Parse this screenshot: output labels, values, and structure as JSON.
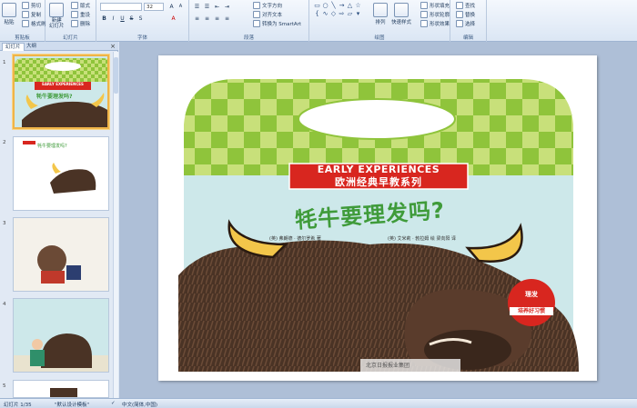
{
  "ribbon": {
    "clipboard": {
      "label": "剪贴板",
      "paste": "粘贴",
      "cut": "剪切",
      "copy": "复制",
      "format_painter": "格式刷"
    },
    "slides": {
      "label": "幻灯片",
      "new_slide": "新建\n幻灯片",
      "layout": "版式",
      "reset": "重设",
      "delete": "删除"
    },
    "font": {
      "label": "字体",
      "font_size": "32"
    },
    "paragraph": {
      "label": "段落",
      "text_direction": "文字方向",
      "align_text": "对齐文本",
      "smartart": "转换为 SmartArt"
    },
    "drawing": {
      "label": "绘图",
      "arrange": "排列",
      "quick_styles": "快速样式",
      "shape_fill": "形状填充",
      "shape_outline": "形状轮廓",
      "shape_effects": "形状效果"
    },
    "editing": {
      "label": "编辑",
      "find": "查找",
      "replace": "替换",
      "select": "选择"
    }
  },
  "panel": {
    "tabs": [
      "幻灯片",
      "大纲"
    ],
    "close": "×",
    "thumb_numbers": [
      "1",
      "2",
      "3",
      "4",
      "5"
    ]
  },
  "cover": {
    "banner_en": "EARLY EXPERIENCES",
    "banner_cn": "欧洲经典早教系列",
    "title": "牦牛要理发吗?",
    "credits_left": "(英) 弗朗德 · 德尔罗希  著",
    "credits_right": "(英) 艾米莉 · 勃拉姆   绘    梁向阳  译",
    "badge_top": "理发",
    "badge_bottom": "培养好习惯",
    "publisher": "北京日报报业集团"
  },
  "thumb_cover": {
    "banner_en": "EARLY EXPERIENCES",
    "title": "牦牛要理发吗?"
  },
  "thumb2": {
    "title": "牦牛要理发吗?"
  },
  "status": {
    "slide_count": "幻灯片 1/35",
    "theme": "\"默认设计模板\"",
    "language": "中文(简体,中国)"
  },
  "colors": {
    "checker_light": "#c8e07a",
    "checker_dark": "#8fc43b",
    "banner_red": "#d8261f",
    "sky_blue": "#cde8ea",
    "title_green": "#3f9b3a",
    "yak_brown": "#4a3325",
    "horn_yellow": "#f3c64a"
  }
}
